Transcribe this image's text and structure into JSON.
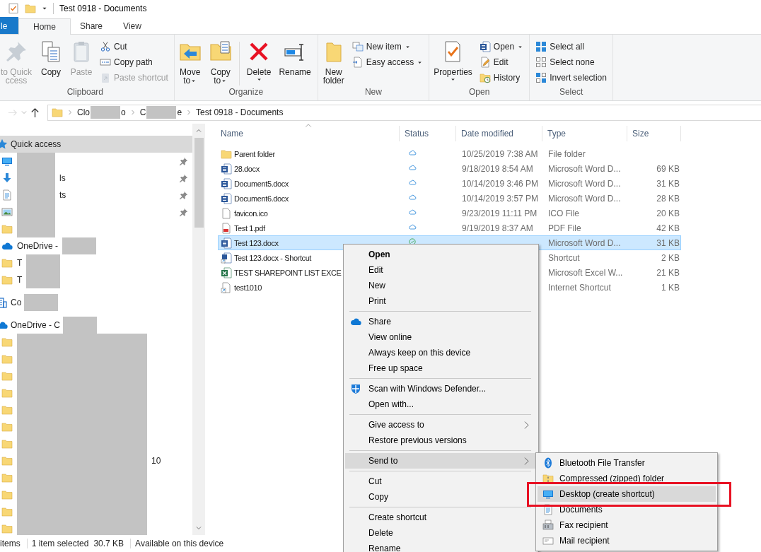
{
  "window": {
    "title": "Test 0918 - Documents"
  },
  "ribbon_tabs": [
    {
      "label": "le",
      "kind": "file",
      "selected": false
    },
    {
      "label": "Home",
      "kind": "tab",
      "selected": true
    },
    {
      "label": "Share",
      "kind": "tab",
      "selected": false
    },
    {
      "label": "View",
      "kind": "tab",
      "selected": false
    }
  ],
  "ribbon_groups": [
    {
      "label": "Clipboard",
      "columns": [
        {
          "kind": "large",
          "buttons": [
            {
              "kind": "pin",
              "lines": [
                "to Quick",
                "ccess"
              ],
              "disabled": true,
              "dropdown": false
            }
          ]
        },
        {
          "kind": "large",
          "buttons": [
            {
              "kind": "copy",
              "lines": [
                "Copy"
              ],
              "disabled": false,
              "dropdown": false
            }
          ]
        },
        {
          "kind": "large",
          "buttons": [
            {
              "kind": "paste",
              "lines": [
                "Paste"
              ],
              "disabled": true,
              "dropdown": false
            }
          ]
        },
        {
          "kind": "stack",
          "buttons": [
            {
              "kind": "scissors",
              "lines": [
                "Cut"
              ],
              "disabled": false,
              "dropdown": false
            },
            {
              "kind": "path",
              "lines": [
                "Copy path"
              ],
              "disabled": false,
              "dropdown": false
            },
            {
              "kind": "pasteshortcut",
              "lines": [
                "Paste shortcut"
              ],
              "disabled": true,
              "dropdown": false
            }
          ]
        }
      ]
    },
    {
      "label": "Organize",
      "columns": [
        {
          "kind": "large",
          "buttons": [
            {
              "kind": "move",
              "lines": [
                "Move",
                "to"
              ],
              "disabled": false,
              "dropdown": true
            }
          ]
        },
        {
          "kind": "large",
          "buttons": [
            {
              "kind": "copyto",
              "lines": [
                "Copy",
                "to"
              ],
              "disabled": false,
              "dropdown": true
            }
          ]
        },
        {
          "kind": "divider"
        },
        {
          "kind": "large",
          "buttons": [
            {
              "kind": "delete",
              "lines": [
                "Delete"
              ],
              "disabled": false,
              "dropdown": true
            }
          ]
        },
        {
          "kind": "large",
          "buttons": [
            {
              "kind": "rename",
              "lines": [
                "Rename"
              ],
              "disabled": false,
              "dropdown": false
            }
          ]
        }
      ]
    },
    {
      "label": "New",
      "columns": [
        {
          "kind": "large",
          "buttons": [
            {
              "kind": "newfolder",
              "lines": [
                "New",
                "folder"
              ],
              "disabled": false,
              "dropdown": false
            }
          ]
        },
        {
          "kind": "stack",
          "buttons": [
            {
              "kind": "newitem",
              "lines": [
                "New item"
              ],
              "disabled": false,
              "dropdown": true
            },
            {
              "kind": "easyaccess",
              "lines": [
                "Easy access"
              ],
              "disabled": false,
              "dropdown": true
            }
          ]
        }
      ]
    },
    {
      "label": "Open",
      "columns": [
        {
          "kind": "large",
          "buttons": [
            {
              "kind": "properties",
              "lines": [
                "Properties"
              ],
              "disabled": false,
              "dropdown": true
            }
          ]
        },
        {
          "kind": "stack",
          "buttons": [
            {
              "kind": "word",
              "lines": [
                "Open"
              ],
              "disabled": false,
              "dropdown": true
            },
            {
              "kind": "edit",
              "lines": [
                "Edit"
              ],
              "disabled": false,
              "dropdown": false
            },
            {
              "kind": "history",
              "lines": [
                "History"
              ],
              "disabled": false,
              "dropdown": false
            }
          ]
        }
      ]
    },
    {
      "label": "Select",
      "columns": [
        {
          "kind": "stack",
          "buttons": [
            {
              "kind": "selectall",
              "lines": [
                "Select all"
              ],
              "disabled": false,
              "dropdown": false
            },
            {
              "kind": "selectnone",
              "lines": [
                "Select none"
              ],
              "disabled": false,
              "dropdown": false
            },
            {
              "kind": "invert",
              "lines": [
                "Invert selection"
              ],
              "disabled": false,
              "dropdown": false
            }
          ]
        }
      ]
    }
  ],
  "address_bar": {
    "nav_buttons": [
      {
        "kind": "forward",
        "disabled": true
      },
      {
        "kind": "recent",
        "disabled": false
      },
      {
        "kind": "up",
        "disabled": false
      }
    ],
    "breadcrumbs": [
      {
        "kind": "redacted",
        "start": "Clo",
        "end": "o"
      },
      {
        "kind": "redacted",
        "start": "C",
        "end": "e"
      },
      {
        "kind": "plain",
        "label": "Test 0918 - Documents"
      }
    ]
  },
  "navigation_pane": {
    "items": [
      {
        "kind": "quick",
        "label": "Quick access",
        "masked": false,
        "label_first": false,
        "wide": false,
        "selected": true,
        "children": [
          {
            "kind": "desktop",
            "masked": true,
            "label_first": false,
            "wide": false,
            "pinned": true,
            "selected": false
          },
          {
            "kind": "downloads",
            "label": "ls",
            "masked": true,
            "label_first": false,
            "wide": false,
            "pinned": true,
            "selected": false
          },
          {
            "kind": "documents",
            "label": "ts",
            "masked": true,
            "label_first": false,
            "wide": false,
            "pinned": true,
            "selected": false
          },
          {
            "kind": "pictures",
            "masked": true,
            "label_first": false,
            "wide": false,
            "pinned": true,
            "selected": false
          },
          {
            "kind": "folder",
            "masked": true,
            "label_first": false,
            "wide": false,
            "pinned": false,
            "selected": false
          },
          {
            "kind": "onedrive",
            "label": "OneDrive -",
            "masked": true,
            "label_first": true,
            "wide": false,
            "pinned": false,
            "selected": false
          },
          {
            "kind": "folder",
            "label": "T",
            "masked": true,
            "label_first": true,
            "wide": false,
            "pinned": false,
            "selected": false
          },
          {
            "kind": "folder",
            "label": "T",
            "masked": true,
            "label_first": true,
            "wide": false,
            "pinned": false,
            "selected": false
          }
        ]
      },
      {
        "kind": "company",
        "label": "Co",
        "masked": true,
        "label_first": true,
        "wide": false,
        "selected": false
      },
      {
        "kind": "onedrive",
        "label": "OneDrive - C",
        "masked": true,
        "label_first": true,
        "wide": false,
        "selected": false,
        "children": [
          {
            "kind": "folder",
            "masked": true,
            "label_first": false,
            "wide": true,
            "selected": false
          },
          {
            "kind": "folder",
            "masked": true,
            "label_first": false,
            "wide": true,
            "selected": false
          },
          {
            "kind": "folder",
            "masked": true,
            "label_first": false,
            "wide": true,
            "selected": false
          },
          {
            "kind": "folder",
            "masked": true,
            "label_first": false,
            "wide": true,
            "selected": false
          },
          {
            "kind": "folder",
            "masked": true,
            "label_first": false,
            "wide": true,
            "selected": false
          },
          {
            "kind": "folder",
            "masked": true,
            "label_first": false,
            "wide": true,
            "selected": false
          },
          {
            "kind": "folder",
            "masked": true,
            "label_first": false,
            "wide": true,
            "selected": false
          },
          {
            "kind": "folder",
            "label": "10",
            "masked": true,
            "label_first": false,
            "wide": true,
            "selected": false
          },
          {
            "kind": "folder",
            "masked": true,
            "label_first": false,
            "wide": true,
            "selected": false
          },
          {
            "kind": "folder",
            "masked": true,
            "label_first": false,
            "wide": true,
            "selected": false
          },
          {
            "kind": "folder",
            "masked": true,
            "label_first": false,
            "wide": true,
            "selected": false
          },
          {
            "kind": "folder",
            "masked": true,
            "label_first": false,
            "wide": true,
            "selected": false
          }
        ]
      }
    ]
  },
  "file_list": {
    "columns": [
      {
        "label": "Name",
        "sorted": true
      },
      {
        "label": "Status",
        "sorted": false
      },
      {
        "label": "Date modified",
        "sorted": false
      },
      {
        "label": "Type",
        "sorted": false
      },
      {
        "label": "Size",
        "sorted": false
      }
    ],
    "rows": [
      {
        "name": "Parent folder",
        "kind": "folder",
        "synced": false,
        "date": "10/25/2019 7:38 AM",
        "type": "File folder",
        "selected": false
      },
      {
        "name": "28.docx",
        "kind": "word",
        "synced": false,
        "date": "9/18/2019 8:54 AM",
        "type": "Microsoft Word D...",
        "size": "69 KB",
        "selected": false
      },
      {
        "name": "Document5.docx",
        "kind": "word",
        "synced": false,
        "date": "10/14/2019 3:46 PM",
        "type": "Microsoft Word D...",
        "size": "31 KB",
        "selected": false
      },
      {
        "name": "Document6.docx",
        "kind": "word",
        "synced": false,
        "date": "10/14/2019 3:57 PM",
        "type": "Microsoft Word D...",
        "size": "28 KB",
        "selected": false
      },
      {
        "name": "favicon.ico",
        "kind": "blank",
        "synced": false,
        "date": "9/23/2019 11:11 PM",
        "type": "ICO File",
        "size": "20 KB",
        "selected": false
      },
      {
        "name": "Test 1.pdf",
        "kind": "pdf",
        "synced": false,
        "date": "9/19/2019 8:37 AM",
        "type": "PDF File",
        "size": "42 KB",
        "selected": false
      },
      {
        "name": "Test 123.docx",
        "kind": "word",
        "synced": true,
        "type": "Microsoft Word D...",
        "size": "31 KB",
        "selected": true
      },
      {
        "name": "Test 123.docx - Shortcut",
        "kind": "shortcut",
        "type": "Shortcut",
        "size": "2 KB",
        "selected": false
      },
      {
        "name": "TEST SHAREPOINT LIST EXCE",
        "kind": "excel",
        "type": "Microsoft Excel W...",
        "size": "21 KB",
        "selected": false
      },
      {
        "name": "test1010",
        "kind": "link",
        "type": "Internet Shortcut",
        "size": "1 KB",
        "selected": false
      }
    ]
  },
  "context_menu": {
    "items": [
      {
        "kind": "default",
        "label": "Open",
        "selected": false
      },
      {
        "kind": "item",
        "label": "Edit",
        "selected": false
      },
      {
        "kind": "item",
        "label": "New",
        "selected": false
      },
      {
        "kind": "item",
        "label": "Print",
        "selected": false
      },
      {
        "kind": "separator"
      },
      {
        "kind": "cloud",
        "label": "Share",
        "selected": false
      },
      {
        "kind": "item",
        "label": "View online",
        "selected": false
      },
      {
        "kind": "item",
        "label": "Always keep on this device",
        "selected": false
      },
      {
        "kind": "item",
        "label": "Free up space",
        "selected": false
      },
      {
        "kind": "separator"
      },
      {
        "kind": "shield",
        "label": "Scan with Windows Defender...",
        "selected": false
      },
      {
        "kind": "item",
        "label": "Open with...",
        "selected": false
      },
      {
        "kind": "separator"
      },
      {
        "kind": "submenu",
        "label": "Give access to",
        "selected": false
      },
      {
        "kind": "item",
        "label": "Restore previous versions",
        "selected": false
      },
      {
        "kind": "separator"
      },
      {
        "kind": "submenu",
        "label": "Send to",
        "selected": true
      },
      {
        "kind": "separator"
      },
      {
        "kind": "item",
        "label": "Cut",
        "selected": false
      },
      {
        "kind": "item",
        "label": "Copy",
        "selected": false
      },
      {
        "kind": "separator"
      },
      {
        "kind": "item",
        "label": "Create shortcut",
        "selected": false
      },
      {
        "kind": "item",
        "label": "Delete",
        "selected": false
      },
      {
        "kind": "item",
        "label": "Rename",
        "selected": false
      }
    ]
  },
  "send_to_menu": {
    "items": [
      {
        "kind": "bluetooth",
        "label": "Bluetooth File Transfer",
        "selected": false,
        "annotated": false
      },
      {
        "kind": "zip",
        "label": "Compressed (zipped) folder",
        "selected": false,
        "annotated": false
      },
      {
        "kind": "desktop",
        "label": "Desktop (create shortcut)",
        "selected": true,
        "annotated": true
      },
      {
        "kind": "documents",
        "label": "Documents",
        "selected": false,
        "annotated": false
      },
      {
        "kind": "fax",
        "label": "Fax recipient",
        "selected": false,
        "annotated": false
      },
      {
        "kind": "mail",
        "label": "Mail recipient",
        "selected": false,
        "annotated": false
      }
    ]
  },
  "status_bar": {
    "item_count": "items",
    "selection": "1 item selected",
    "selection_size": "30.7 KB",
    "availability": "Available on this device"
  }
}
